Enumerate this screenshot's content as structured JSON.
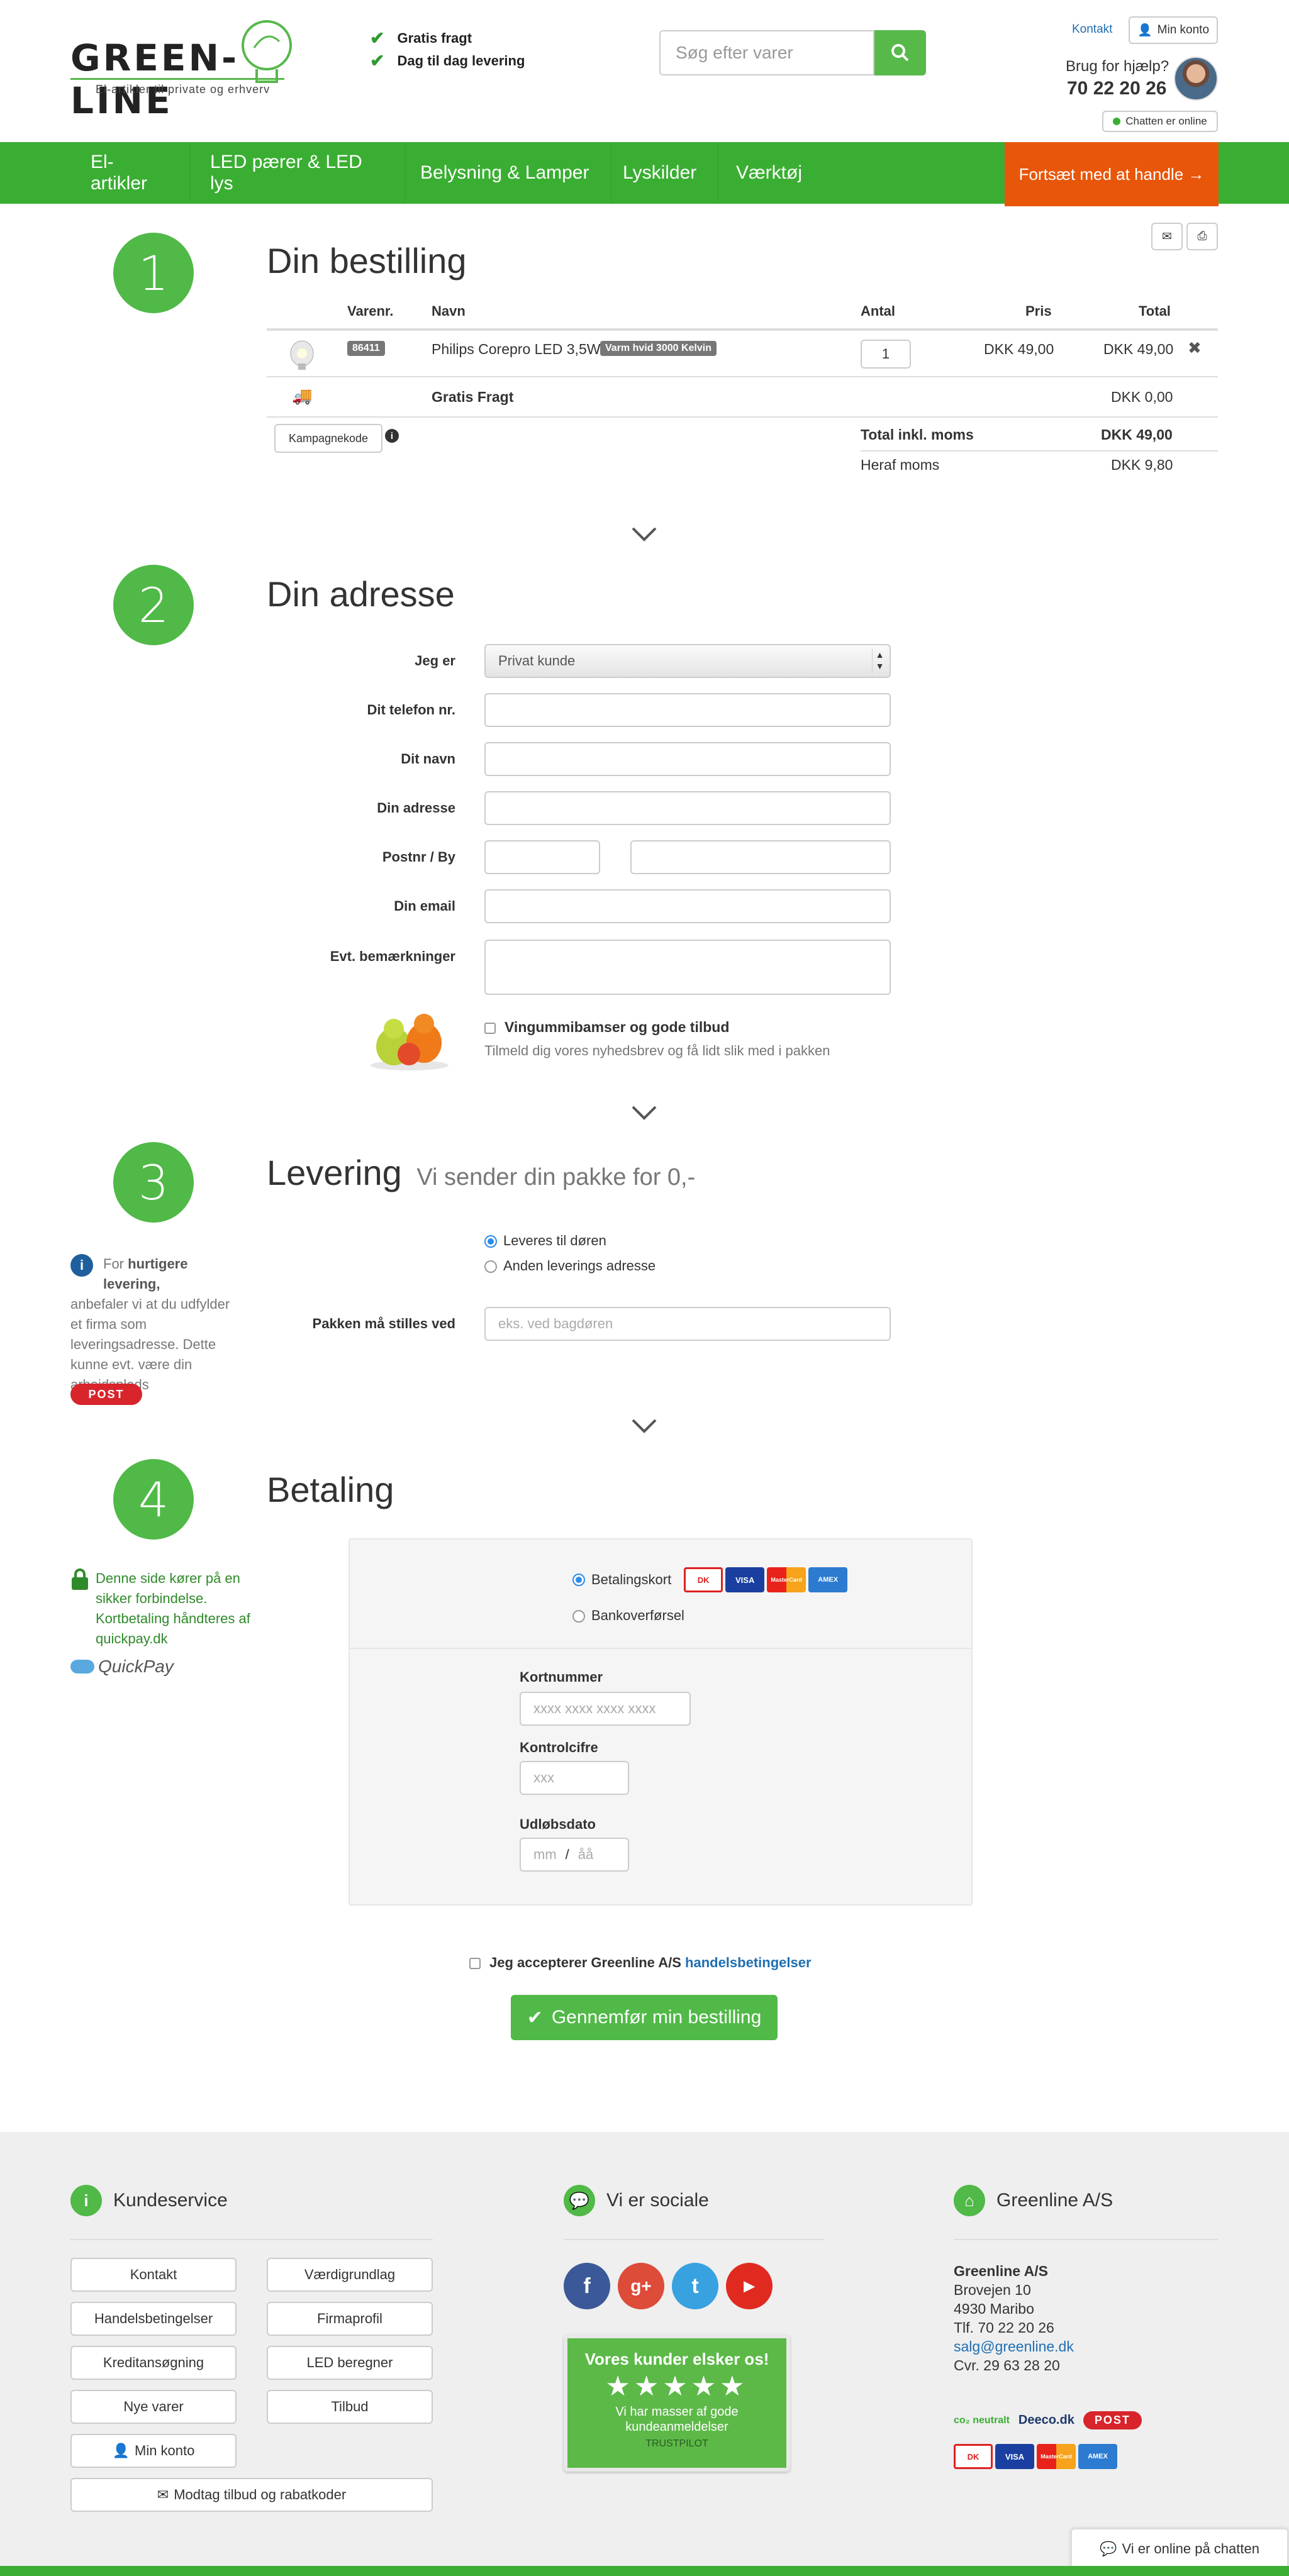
{
  "header": {
    "logo_text": "GREEN-LINE",
    "logo_tagline": "El-artikler til private og erhverv",
    "usps": [
      "Gratis fragt",
      "Dag til dag levering"
    ],
    "search_placeholder": "Søg efter varer",
    "contact_link": "Kontakt",
    "account_button": "Min konto",
    "help_text": "Brug for hjælp?",
    "phone": "70 22 20 26",
    "chat_status": "Chatten er online"
  },
  "nav": {
    "items": [
      "El-artikler",
      "LED pærer & LED lys",
      "Belysning & Lamper",
      "Lyskilder",
      "Værktøj"
    ],
    "cta": "Fortsæt med at handle →"
  },
  "order": {
    "step": "1",
    "title": "Din bestilling",
    "columns": {
      "sku": "Varenr.",
      "name": "Navn",
      "qty": "Antal",
      "price": "Pris",
      "total": "Total"
    },
    "item": {
      "sku": "86411",
      "name": "Philips Corepro LED 3,5W",
      "variant": "Varm hvid 3000 Kelvin",
      "qty": "1",
      "price": "DKK 49,00",
      "total": "DKK 49,00"
    },
    "shipping": {
      "label": "Gratis Fragt",
      "total": "DKK 0,00"
    },
    "campaign_button": "Kampagnekode",
    "total_label": "Total inkl. moms",
    "total_value": "DKK 49,00",
    "vat_label": "Heraf moms",
    "vat_value": "DKK 9,80"
  },
  "address": {
    "step": "2",
    "title": "Din adresse",
    "labels": {
      "type": "Jeg er",
      "phone": "Dit telefon nr.",
      "name": "Dit navn",
      "address": "Din adresse",
      "zip": "Postnr / By",
      "email": "Din email",
      "notes": "Evt. bemærkninger"
    },
    "type_value": "Privat kunde",
    "newsletter_label": "Vingummibamser og gode tilbud",
    "newsletter_sub": "Tilmeld dig vores nyhedsbrev og få lidt slik med i pakken"
  },
  "delivery": {
    "step": "3",
    "title": "Levering",
    "subtitle": "Vi sender din pakke for 0,-",
    "option_door": "Leveres til døren",
    "option_other": "Anden leverings adresse",
    "drop_label": "Pakken må stilles ved",
    "drop_placeholder": "eks. ved bagdøren",
    "side_note_prefix": "For",
    "side_note_bold": "hurtigere levering,",
    "side_note_rest": "anbefaler vi at du udfylder et firma som leveringsadresse. Dette kunne evt. være din arbejdsplads",
    "post_logo": "POST"
  },
  "payment": {
    "step": "4",
    "title": "Betaling",
    "option_card": "Betalingskort",
    "option_transfer": "Bankoverførsel",
    "card_number_label": "Kortnummer",
    "card_number_placeholder": "xxxx xxxx xxxx xxxx",
    "cvc_label": "Kontrolcifre",
    "cvc_placeholder": "xxx",
    "expiry_label": "Udløbsdato",
    "expiry_mm": "mm",
    "expiry_sep": "/",
    "expiry_yy": "åå",
    "secure_note": "Denne side kører på en sikker forbindelse. Kortbetaling håndteres af quickpay.dk",
    "quickpay_logo": "QuickPay",
    "card_brands": [
      "DK",
      "VISA",
      "MasterCard",
      "AMEX"
    ]
  },
  "checkout": {
    "terms_text": "Jeg accepterer Greenline A/S",
    "terms_link": "handelsbetingelser",
    "submit": "Gennemfør min bestilling"
  },
  "footer": {
    "service_title": "Kundeservice",
    "service_buttons": [
      "Kontakt",
      "Værdigrundlag",
      "Handelsbetingelser",
      "Firmaprofil",
      "Kreditansøgning",
      "LED beregner",
      "Nye varer",
      "Tilbud"
    ],
    "account_button": "Min konto",
    "offers_button": "Modtag tilbud og rabatkoder",
    "social_title": "Vi er sociale",
    "trust_title": "Vores kunder elsker os!",
    "trust_stars": "★★★★★",
    "trust_text": "Vi har masser af gode kundeanmeldelser",
    "trust_brand": "TRUSTPILOT",
    "company_title": "Greenline A/S",
    "company_name": "Greenline A/S",
    "company_street": "Brovejen 10",
    "company_city": "4930 Maribo",
    "company_phone": "Tlf. 70 22 20 26",
    "company_email": "salg@greenline.dk",
    "company_cvr": "Cvr. 29 63 28 20",
    "partner_logos": [
      "co₂ neutralt",
      "Deeco.dk",
      "POST"
    ],
    "chat_button": "Vi er online på chatten"
  },
  "colors": {
    "brand_green": "#3aae32",
    "cta_orange": "#e8560a",
    "step_green": "#50b947",
    "link_blue": "#1f6fb2"
  }
}
